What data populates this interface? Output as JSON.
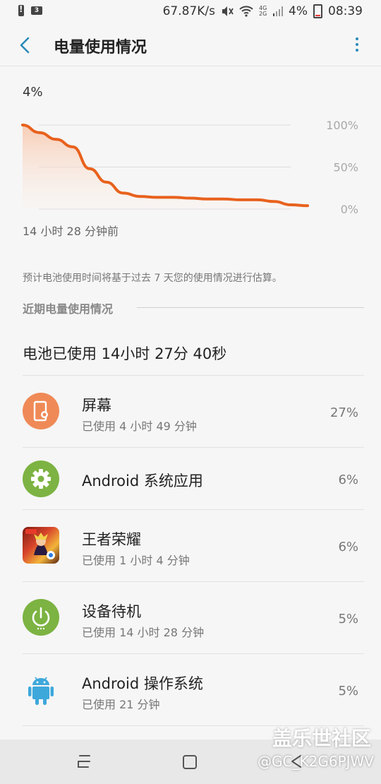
{
  "status_bar": {
    "speed": "67.87K/s",
    "network": "4G 2G",
    "battery_percent": "4%",
    "time": "08:39",
    "sim_label": "3"
  },
  "header": {
    "title": "电量使用情况",
    "back_icon": "chevron-left-icon",
    "more_icon": "more-vert-icon"
  },
  "chart": {
    "current_level": "4%",
    "time_ago_label": "14 小时 28 分钟前",
    "y_ticks": [
      "100%",
      "50%",
      "0%"
    ],
    "line_color": "#e8611d",
    "fill_color": "#f7c8ae"
  },
  "chart_data": {
    "type": "area",
    "x_label": "",
    "y_label": "",
    "ylim": [
      0,
      100
    ],
    "x": [
      0,
      1,
      2,
      3,
      4,
      5,
      6,
      7,
      8,
      9,
      10,
      11,
      12,
      13,
      14,
      15,
      16,
      17
    ],
    "values": [
      100,
      91,
      83,
      74,
      48,
      32,
      19,
      15,
      14,
      14,
      13,
      12,
      12,
      11,
      11,
      9,
      5,
      4
    ]
  },
  "estimate_note": "预计电池使用时间将基于过去 7 天您的使用情况进行估算。",
  "recent_section": {
    "title": "近期电量使用情况",
    "summary": "电池已使用 14小时 27分 40秒"
  },
  "usage_list": [
    {
      "name": "屏幕",
      "subtitle": "已使用 4 小时 49 分钟",
      "percent": "27%",
      "icon": "screen-brightness-icon",
      "color": "#ef8a57"
    },
    {
      "name": "Android 系统应用",
      "subtitle": "",
      "percent": "6%",
      "icon": "gear-icon",
      "color": "#7cb342"
    },
    {
      "name": "王者荣耀",
      "subtitle": "已使用 1 小时 4 分钟",
      "percent": "6%",
      "icon": "game-app-icon",
      "color": "#c62828"
    },
    {
      "name": "设备待机",
      "subtitle": "已使用 14 小时 28 分钟",
      "percent": "5%",
      "icon": "power-icon",
      "color": "#7cb342"
    },
    {
      "name": "Android 操作系统",
      "subtitle": "已使用 21 分钟",
      "percent": "5%",
      "icon": "android-icon",
      "color": "#3ea8db"
    }
  ],
  "watermark": {
    "site": "盖乐世社区",
    "user": "@GC_K2G6PJWV"
  }
}
